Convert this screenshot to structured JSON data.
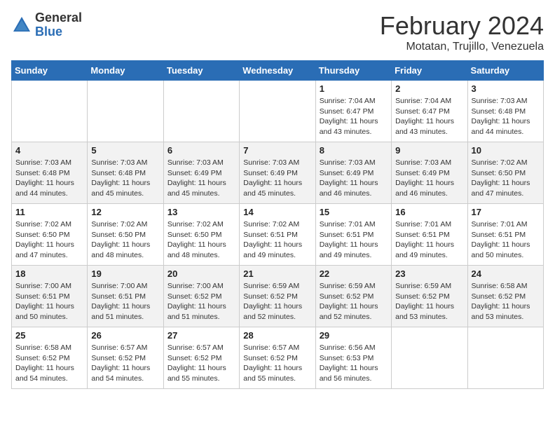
{
  "header": {
    "logo_general": "General",
    "logo_blue": "Blue",
    "month_title": "February 2024",
    "location": "Motatan, Trujillo, Venezuela"
  },
  "days_of_week": [
    "Sunday",
    "Monday",
    "Tuesday",
    "Wednesday",
    "Thursday",
    "Friday",
    "Saturday"
  ],
  "weeks": [
    [
      {
        "day": "",
        "empty": true
      },
      {
        "day": "",
        "empty": true
      },
      {
        "day": "",
        "empty": true
      },
      {
        "day": "",
        "empty": true
      },
      {
        "day": "1",
        "sunrise": "7:04 AM",
        "sunset": "6:47 PM",
        "daylight": "11 hours and 43 minutes."
      },
      {
        "day": "2",
        "sunrise": "7:04 AM",
        "sunset": "6:47 PM",
        "daylight": "11 hours and 43 minutes."
      },
      {
        "day": "3",
        "sunrise": "7:03 AM",
        "sunset": "6:48 PM",
        "daylight": "11 hours and 44 minutes."
      }
    ],
    [
      {
        "day": "4",
        "sunrise": "7:03 AM",
        "sunset": "6:48 PM",
        "daylight": "11 hours and 44 minutes."
      },
      {
        "day": "5",
        "sunrise": "7:03 AM",
        "sunset": "6:48 PM",
        "daylight": "11 hours and 45 minutes."
      },
      {
        "day": "6",
        "sunrise": "7:03 AM",
        "sunset": "6:49 PM",
        "daylight": "11 hours and 45 minutes."
      },
      {
        "day": "7",
        "sunrise": "7:03 AM",
        "sunset": "6:49 PM",
        "daylight": "11 hours and 45 minutes."
      },
      {
        "day": "8",
        "sunrise": "7:03 AM",
        "sunset": "6:49 PM",
        "daylight": "11 hours and 46 minutes."
      },
      {
        "day": "9",
        "sunrise": "7:03 AM",
        "sunset": "6:49 PM",
        "daylight": "11 hours and 46 minutes."
      },
      {
        "day": "10",
        "sunrise": "7:02 AM",
        "sunset": "6:50 PM",
        "daylight": "11 hours and 47 minutes."
      }
    ],
    [
      {
        "day": "11",
        "sunrise": "7:02 AM",
        "sunset": "6:50 PM",
        "daylight": "11 hours and 47 minutes."
      },
      {
        "day": "12",
        "sunrise": "7:02 AM",
        "sunset": "6:50 PM",
        "daylight": "11 hours and 48 minutes."
      },
      {
        "day": "13",
        "sunrise": "7:02 AM",
        "sunset": "6:50 PM",
        "daylight": "11 hours and 48 minutes."
      },
      {
        "day": "14",
        "sunrise": "7:02 AM",
        "sunset": "6:51 PM",
        "daylight": "11 hours and 49 minutes."
      },
      {
        "day": "15",
        "sunrise": "7:01 AM",
        "sunset": "6:51 PM",
        "daylight": "11 hours and 49 minutes."
      },
      {
        "day": "16",
        "sunrise": "7:01 AM",
        "sunset": "6:51 PM",
        "daylight": "11 hours and 49 minutes."
      },
      {
        "day": "17",
        "sunrise": "7:01 AM",
        "sunset": "6:51 PM",
        "daylight": "11 hours and 50 minutes."
      }
    ],
    [
      {
        "day": "18",
        "sunrise": "7:00 AM",
        "sunset": "6:51 PM",
        "daylight": "11 hours and 50 minutes."
      },
      {
        "day": "19",
        "sunrise": "7:00 AM",
        "sunset": "6:51 PM",
        "daylight": "11 hours and 51 minutes."
      },
      {
        "day": "20",
        "sunrise": "7:00 AM",
        "sunset": "6:52 PM",
        "daylight": "11 hours and 51 minutes."
      },
      {
        "day": "21",
        "sunrise": "6:59 AM",
        "sunset": "6:52 PM",
        "daylight": "11 hours and 52 minutes."
      },
      {
        "day": "22",
        "sunrise": "6:59 AM",
        "sunset": "6:52 PM",
        "daylight": "11 hours and 52 minutes."
      },
      {
        "day": "23",
        "sunrise": "6:59 AM",
        "sunset": "6:52 PM",
        "daylight": "11 hours and 53 minutes."
      },
      {
        "day": "24",
        "sunrise": "6:58 AM",
        "sunset": "6:52 PM",
        "daylight": "11 hours and 53 minutes."
      }
    ],
    [
      {
        "day": "25",
        "sunrise": "6:58 AM",
        "sunset": "6:52 PM",
        "daylight": "11 hours and 54 minutes."
      },
      {
        "day": "26",
        "sunrise": "6:57 AM",
        "sunset": "6:52 PM",
        "daylight": "11 hours and 54 minutes."
      },
      {
        "day": "27",
        "sunrise": "6:57 AM",
        "sunset": "6:52 PM",
        "daylight": "11 hours and 55 minutes."
      },
      {
        "day": "28",
        "sunrise": "6:57 AM",
        "sunset": "6:52 PM",
        "daylight": "11 hours and 55 minutes."
      },
      {
        "day": "29",
        "sunrise": "6:56 AM",
        "sunset": "6:53 PM",
        "daylight": "11 hours and 56 minutes."
      },
      {
        "day": "",
        "empty": true
      },
      {
        "day": "",
        "empty": true
      }
    ]
  ]
}
